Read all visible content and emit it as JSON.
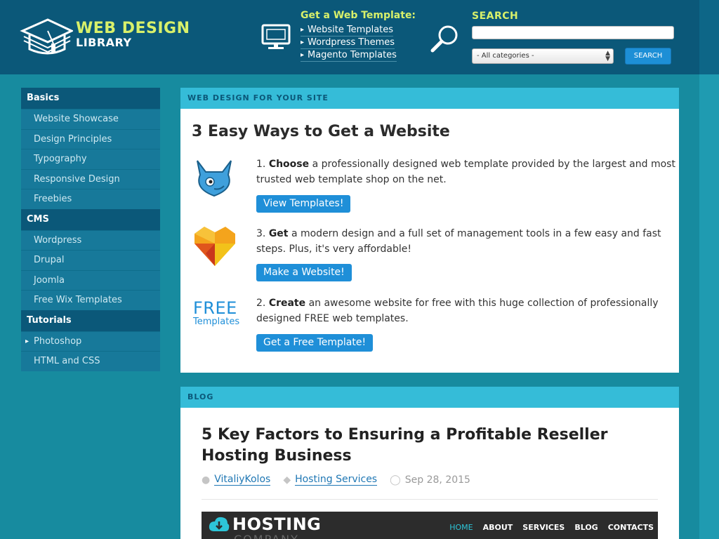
{
  "header": {
    "logo_line1": "WEB DESIGN",
    "logo_line2": "LIBRARY",
    "templates_title": "Get a Web Template:",
    "template_links": [
      "Website Templates",
      "Wordpress Themes",
      "Magento Templates"
    ],
    "search_label": "SEARCH",
    "search_value": "",
    "category_selected": "- All categories -",
    "search_button": "SEARCH"
  },
  "sidebar": {
    "sections": [
      {
        "title": "Basics",
        "items": [
          "Website Showcase",
          "Design Principles",
          "Typography",
          "Responsive Design",
          "Freebies"
        ]
      },
      {
        "title": "CMS",
        "items": [
          "Wordpress",
          "Drupal",
          "Joomla",
          "Free Wix Templates"
        ]
      },
      {
        "title": "Tutorials",
        "items": [
          "Photoshop",
          "HTML and CSS"
        ]
      }
    ]
  },
  "card1": {
    "header": "WEB DESIGN FOR YOUR SITE",
    "title": "3 Easy Ways to Get a Website",
    "steps": [
      {
        "num": "1.",
        "bold": "Choose",
        "text": " a professionally designed web template provided by the largest and most trusted web template shop on the net.",
        "button": "View Templates!"
      },
      {
        "num": "3.",
        "bold": "Get",
        "text": " a modern design and a full set of management tools in a few easy and fast steps. Plus, it's very affordable!",
        "button": "Make a Website!"
      },
      {
        "num": "2.",
        "bold": "Create",
        "text": " an awesome website for free with this huge collection of professionally designed FREE web templates.",
        "button": "Get a Free Template!"
      }
    ],
    "free_line1": "FREE",
    "free_line2": "Templates"
  },
  "card2": {
    "header": "BLOG",
    "title": "5 Key Factors to Ensuring a Profitable Reseller Hosting Business",
    "author": "VitaliyKolos",
    "category": "Hosting Services",
    "date": "Sep 28, 2015",
    "image": {
      "name": "HOSTING",
      "sub": "COMPANY",
      "nav": [
        "HOME",
        "ABOUT",
        "SERVICES",
        "BLOG",
        "CONTACTS"
      ]
    }
  }
}
